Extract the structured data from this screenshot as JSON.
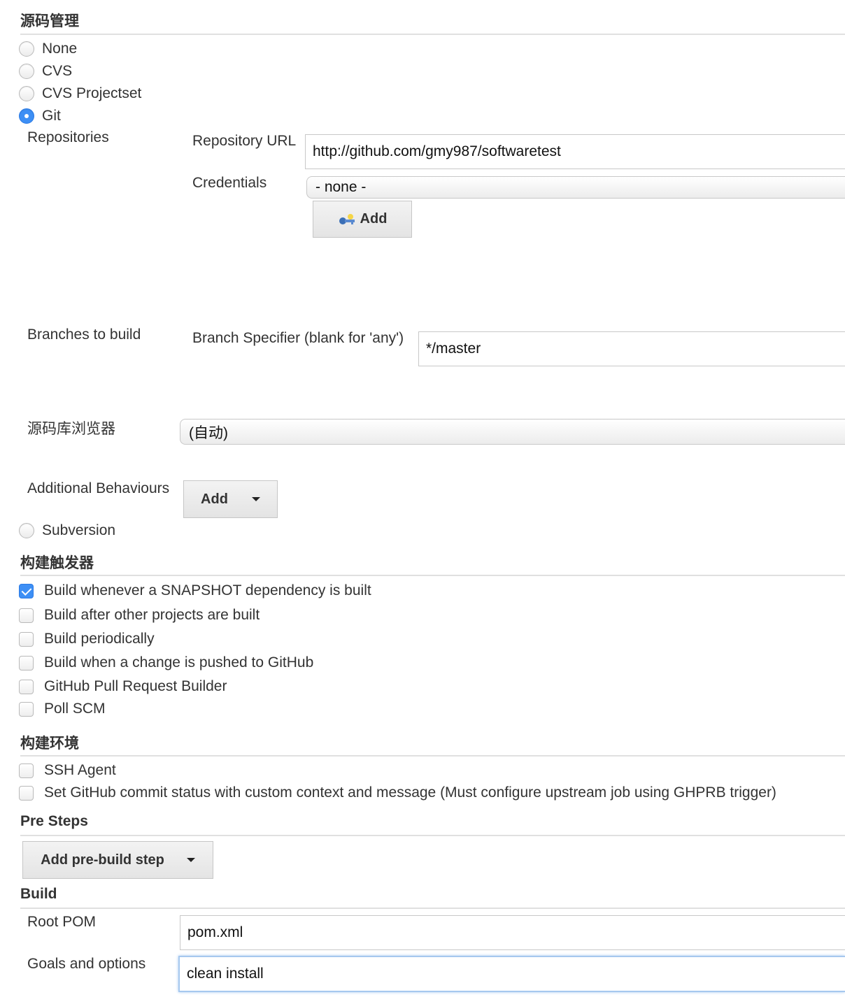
{
  "scm": {
    "heading": "源码管理",
    "options": [
      {
        "label": "None",
        "checked": false
      },
      {
        "label": "CVS",
        "checked": false
      },
      {
        "label": "CVS Projectset",
        "checked": false
      },
      {
        "label": "Git",
        "checked": true
      }
    ],
    "git": {
      "repositories_label": "Repositories",
      "repo_url_label": "Repository URL",
      "repo_url_value": "http://github.com/gmy987/softwaretest",
      "credentials_label": "Credentials",
      "credentials_value": "- none -",
      "add_credentials_label": "Add",
      "branches_label": "Branches to build",
      "branch_specifier_label": "Branch Specifier (blank for 'any')",
      "branch_specifier_value": "*/master",
      "browser_label": "源码库浏览器",
      "browser_value": "(自动)",
      "behaviours_label": "Additional Behaviours",
      "behaviours_add_label": "Add"
    },
    "subversion": {
      "label": "Subversion",
      "checked": false
    }
  },
  "triggers": {
    "heading": "构建触发器",
    "items": [
      {
        "label": "Build whenever a SNAPSHOT dependency is built",
        "checked": true
      },
      {
        "label": "Build after other projects are built",
        "checked": false
      },
      {
        "label": "Build periodically",
        "checked": false
      },
      {
        "label": "Build when a change is pushed to GitHub",
        "checked": false
      },
      {
        "label": "GitHub Pull Request Builder",
        "checked": false
      },
      {
        "label": "Poll SCM",
        "checked": false
      }
    ]
  },
  "environment": {
    "heading": "构建环境",
    "items": [
      {
        "label": "SSH Agent",
        "checked": false
      },
      {
        "label": "Set GitHub commit status with custom context and message (Must configure upstream job using GHPRB trigger)",
        "checked": false
      }
    ]
  },
  "pre_steps": {
    "heading": "Pre Steps",
    "add_label": "Add pre-build step"
  },
  "build": {
    "heading": "Build",
    "root_pom_label": "Root POM",
    "root_pom_value": "pom.xml",
    "goals_label": "Goals and options",
    "goals_value": "clean install"
  },
  "colors": {
    "accent": "#3d8ff5",
    "rule": "#e0e0e0",
    "focus": "#a6c8ef"
  },
  "icons": {
    "credentials_add": "key-icon",
    "dropdown": "caret-down-icon"
  }
}
